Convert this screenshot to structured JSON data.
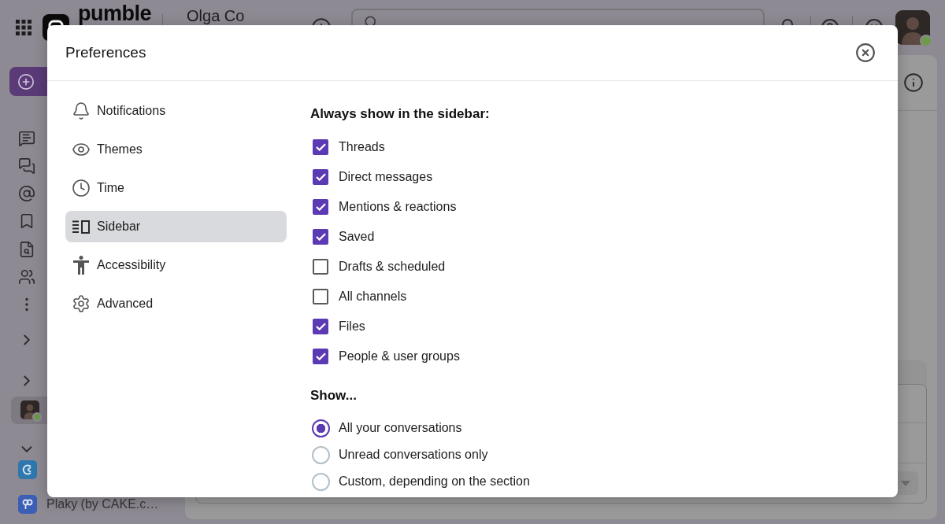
{
  "top_bar": {
    "logo_text": "pumble",
    "workspace": "Olga Co",
    "user": {
      "online": true
    }
  },
  "sidebar": {
    "direct_messages": [
      {
        "selected": true,
        "online": true
      }
    ],
    "apps": [
      {
        "kind": "timer"
      },
      {
        "kind": "board",
        "label": "Plaky (by CAKE.c…"
      }
    ]
  },
  "modal": {
    "title": "Preferences",
    "nav": [
      {
        "label": "Notifications",
        "selected": false
      },
      {
        "label": "Themes",
        "selected": false
      },
      {
        "label": "Time",
        "selected": false
      },
      {
        "label": "Sidebar",
        "selected": true
      },
      {
        "label": "Accessibility",
        "selected": false
      },
      {
        "label": "Advanced",
        "selected": false
      }
    ],
    "sections": [
      {
        "kind": "checklist",
        "heading": "Always show in the sidebar:",
        "options": [
          {
            "label": "Threads",
            "checked": true
          },
          {
            "label": "Direct messages",
            "checked": true
          },
          {
            "label": "Mentions & reactions",
            "checked": true
          },
          {
            "label": "Saved",
            "checked": true
          },
          {
            "label": "Drafts & scheduled",
            "checked": false
          },
          {
            "label": "All channels",
            "checked": false
          },
          {
            "label": "Files",
            "checked": true
          },
          {
            "label": "People & user groups",
            "checked": true
          }
        ]
      },
      {
        "kind": "radio_group",
        "heading": "Show...",
        "options": [
          {
            "label": "All your conversations",
            "selected": true
          },
          {
            "label": "Unread conversations only",
            "selected": false
          },
          {
            "label": "Custom, depending on the section",
            "selected": false
          }
        ]
      }
    ]
  }
}
